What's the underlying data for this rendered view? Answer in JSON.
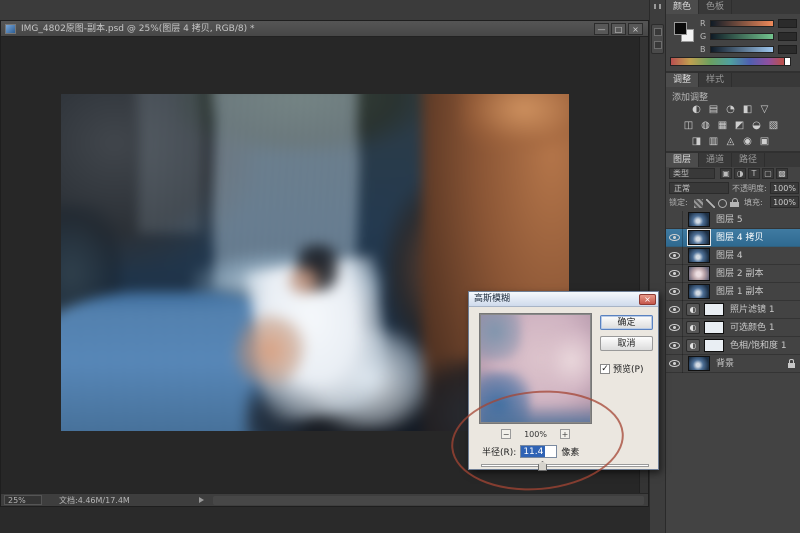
{
  "window": {
    "doc_title": "IMG_4802原图-副本.psd @ 25%(图层 4 拷贝, RGB/8) *",
    "minimize": "—",
    "restore": "□",
    "close": "×",
    "status_zoom": "25%",
    "status_doc": "文档:4.46M/17.4M"
  },
  "color_panel": {
    "tabs": [
      "颜色",
      "色板"
    ],
    "channels": [
      "R",
      "G",
      "B"
    ]
  },
  "adjustments_panel": {
    "tabs": [
      "调整",
      "样式"
    ],
    "add_label": "添加调整",
    "icons": [
      [
        "◐",
        "▤",
        "◔",
        "◧",
        "▽"
      ],
      [
        "◫",
        "◍",
        "▦",
        "◩",
        "◒",
        "▧"
      ],
      [
        "◨",
        "▥",
        "◬",
        "◉",
        "▣"
      ]
    ]
  },
  "layers_panel": {
    "tabs": [
      "图层",
      "通道",
      "路径"
    ],
    "kind_label": "类型",
    "filter_icons": [
      "▣",
      "◑",
      "T",
      "▢",
      "▩"
    ],
    "blend_mode": "正常",
    "opacity_label": "不透明度:",
    "opacity_value": "100%",
    "lock_label": "锁定:",
    "fill_label": "填充:",
    "fill_value": "100%",
    "adjustment_glyph": "◐",
    "layers": [
      {
        "name": "图层 5",
        "visible": false,
        "selected": false,
        "kind": "image"
      },
      {
        "name": "图层 4 拷贝",
        "visible": true,
        "selected": true,
        "kind": "image"
      },
      {
        "name": "图层 4",
        "visible": true,
        "selected": false,
        "kind": "image"
      },
      {
        "name": "图层 2 副本",
        "visible": true,
        "selected": false,
        "kind": "image"
      },
      {
        "name": "图层 1 副本",
        "visible": true,
        "selected": false,
        "kind": "image"
      },
      {
        "name": "照片滤镜 1",
        "visible": true,
        "selected": false,
        "kind": "adjustment"
      },
      {
        "name": "可选颜色 1",
        "visible": true,
        "selected": false,
        "kind": "adjustment"
      },
      {
        "name": "色相/饱和度 1",
        "visible": true,
        "selected": false,
        "kind": "adjustment"
      },
      {
        "name": "背景",
        "visible": true,
        "selected": false,
        "kind": "background",
        "locked": true
      }
    ]
  },
  "dialog": {
    "title": "高斯模糊",
    "close": "×",
    "ok": "确定",
    "cancel": "取消",
    "preview_label": "预览(P)",
    "check_glyph": "✓",
    "zoom_out": "−",
    "zoom_level": "100%",
    "zoom_in": "+",
    "radius_label": "半径(R):",
    "radius_value": "11.4",
    "unit_label": "像素"
  },
  "colors": {
    "selected_layer_blue": "#35719a",
    "selection_text_blue": "#2f63b5",
    "annotation_red": "#a4463a",
    "dialog_bg": "#ebe7e0",
    "panel_bg": "#434343",
    "canvas_bg": "#272727"
  }
}
